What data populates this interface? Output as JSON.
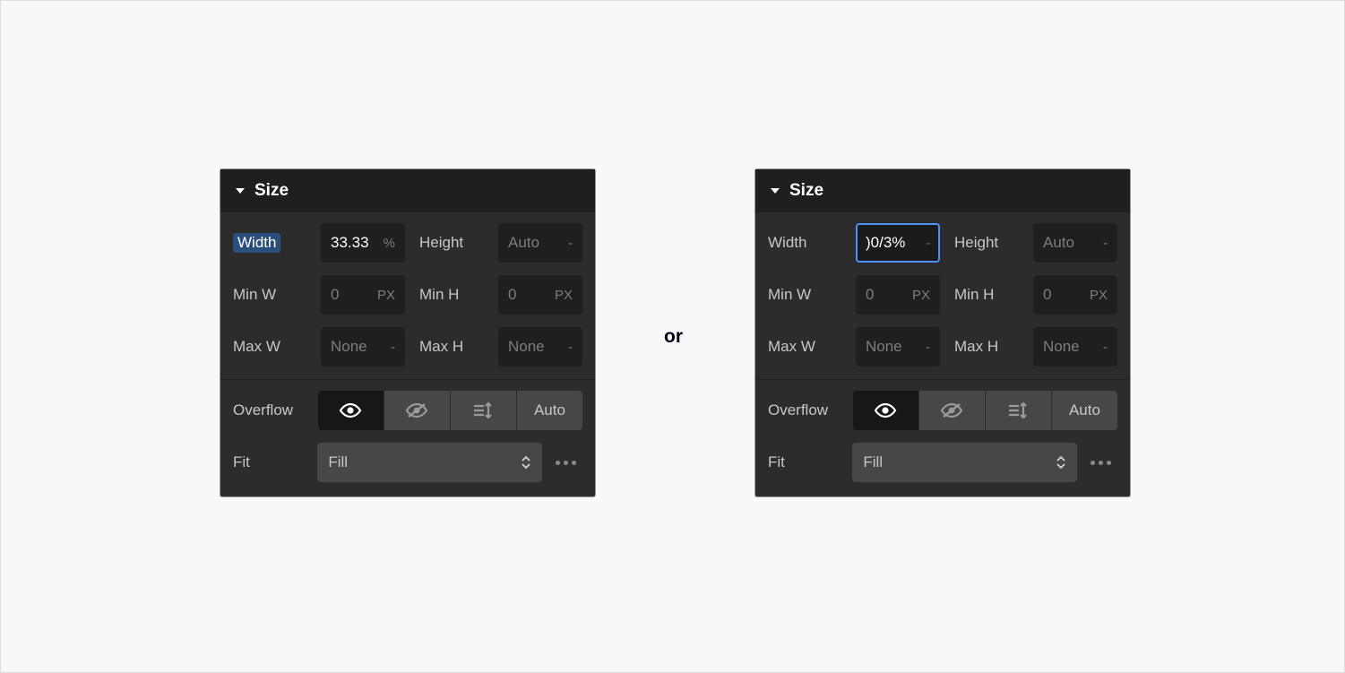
{
  "or_text": "or",
  "left": {
    "title": "Size",
    "width": {
      "label": "Width",
      "value": "33.33",
      "unit": "%"
    },
    "height": {
      "label": "Height",
      "value": "Auto",
      "unit": "-"
    },
    "minw": {
      "label": "Min W",
      "value": "0",
      "unit": "PX"
    },
    "minh": {
      "label": "Min H",
      "value": "0",
      "unit": "PX"
    },
    "maxw": {
      "label": "Max W",
      "value": "None",
      "unit": "-"
    },
    "maxh": {
      "label": "Max H",
      "value": "None",
      "unit": "-"
    },
    "overflow": {
      "label": "Overflow",
      "auto": "Auto"
    },
    "fit": {
      "label": "Fit",
      "value": "Fill"
    }
  },
  "right": {
    "title": "Size",
    "width": {
      "label": "Width",
      "value": ")0/3%",
      "unit": "-"
    },
    "height": {
      "label": "Height",
      "value": "Auto",
      "unit": "-"
    },
    "minw": {
      "label": "Min W",
      "value": "0",
      "unit": "PX"
    },
    "minh": {
      "label": "Min H",
      "value": "0",
      "unit": "PX"
    },
    "maxw": {
      "label": "Max W",
      "value": "None",
      "unit": "-"
    },
    "maxh": {
      "label": "Max H",
      "value": "None",
      "unit": "-"
    },
    "overflow": {
      "label": "Overflow",
      "auto": "Auto"
    },
    "fit": {
      "label": "Fit",
      "value": "Fill"
    }
  }
}
